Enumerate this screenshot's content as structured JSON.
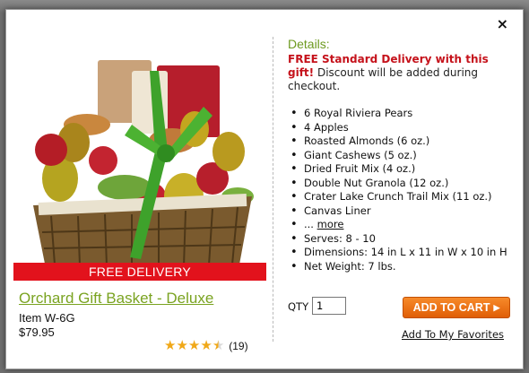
{
  "modal": {
    "close_label": "×"
  },
  "product": {
    "banner": "FREE DELIVERY",
    "title": "Orchard Gift Basket - Deluxe",
    "item_number": "Item W-6G",
    "price": "$79.95",
    "rating_stars": 4.5,
    "rating_count": "(19)"
  },
  "details": {
    "heading": "Details:",
    "promo_bold": "FREE Standard Delivery with this gift!",
    "promo_rest": " Discount will be added during checkout.",
    "features": [
      "6 Royal Riviera Pears",
      "4 Apples",
      "Roasted Almonds (6 oz.)",
      "Giant Cashews (5 oz.)",
      "Dried Fruit Mix (4 oz.)",
      "Double Nut Granola (12 oz.)",
      "Crater Lake Crunch Trail Mix (11 oz.)",
      "Canvas Liner"
    ],
    "more_prefix": "... ",
    "more_link": "more",
    "extra": [
      "Serves: 8 - 10",
      "Dimensions: 14 in L x 11 in W x 10 in H",
      "Net Weight: 7 lbs."
    ]
  },
  "purchase": {
    "qty_label": "QTY",
    "qty_value": "1",
    "add_to_cart": "ADD TO CART",
    "favorites": "Add To My Favorites"
  },
  "colors": {
    "banner_red": "#e2121c",
    "title_green": "#7aa321",
    "button_orange": "#ec6f14",
    "star_gold": "#f0a818"
  }
}
